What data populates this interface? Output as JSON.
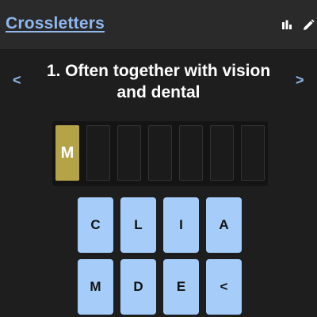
{
  "header": {
    "title": "Crossletters",
    "icons": [
      "stats-icon",
      "edit-icon"
    ]
  },
  "clue": {
    "prev_label": "<",
    "next_label": ">",
    "text": "1. Often together with vision and dental"
  },
  "answer": {
    "slots": [
      "M",
      "",
      "",
      "",
      "",
      "",
      ""
    ],
    "filled_color": "#b5a347"
  },
  "keyboard": {
    "keys": [
      "C",
      "L",
      "I",
      "A",
      "M",
      "D",
      "E",
      "<"
    ],
    "key_color": "#a6ccfa"
  },
  "colors": {
    "background": "#1e1e1e",
    "header": "#2a2a2a",
    "accent": "#8fb8f0"
  }
}
